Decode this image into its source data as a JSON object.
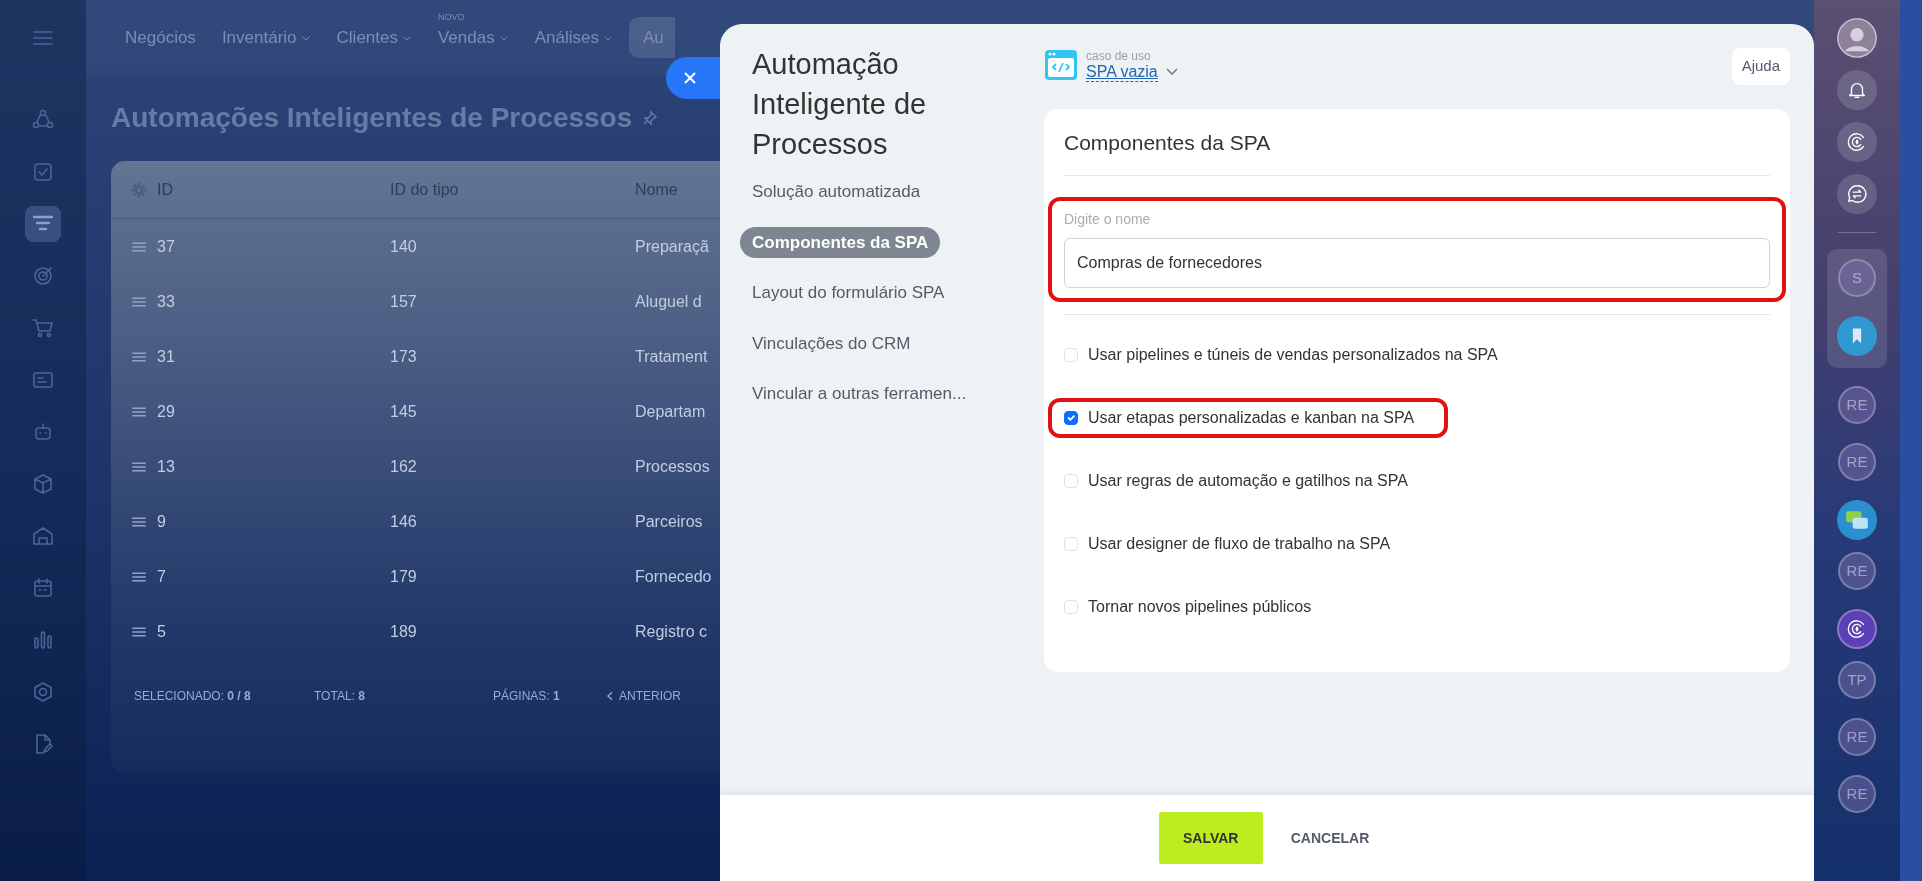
{
  "left_sidebar": {
    "items": [
      {
        "selected": false
      },
      {
        "selected": false
      },
      {
        "selected": false
      },
      {
        "selected": true
      },
      {
        "selected": false
      },
      {
        "selected": false
      },
      {
        "selected": false
      },
      {
        "selected": false
      },
      {
        "selected": false
      },
      {
        "selected": false
      },
      {
        "selected": false
      },
      {
        "selected": false
      },
      {
        "selected": false
      },
      {
        "selected": false
      }
    ]
  },
  "top_nav": {
    "tabs": [
      {
        "label": "Negócios",
        "has_menu": false,
        "selected": false
      },
      {
        "label": "Inventário",
        "has_menu": true,
        "selected": false
      },
      {
        "label": "Clientes",
        "has_menu": true,
        "selected": false
      },
      {
        "label": "Vendas",
        "has_menu": true,
        "selected": false,
        "badge": "NOVO"
      },
      {
        "label": "Análises",
        "has_menu": true,
        "selected": false
      },
      {
        "label": "Au",
        "has_menu": false,
        "selected": true
      }
    ]
  },
  "page_title": "Automações Inteligentes de Processos",
  "table": {
    "columns": [
      "ID",
      "ID do tipo",
      "Nome"
    ],
    "rows": [
      {
        "id": "37",
        "type_id": "140",
        "name": "Preparaçã"
      },
      {
        "id": "33",
        "type_id": "157",
        "name": "Aluguel d"
      },
      {
        "id": "31",
        "type_id": "173",
        "name": "Tratament"
      },
      {
        "id": "29",
        "type_id": "145",
        "name": "Departam"
      },
      {
        "id": "13",
        "type_id": "162",
        "name": "Processos"
      },
      {
        "id": "9",
        "type_id": "146",
        "name": "Parceiros"
      },
      {
        "id": "7",
        "type_id": "179",
        "name": "Fornecedo"
      },
      {
        "id": "5",
        "type_id": "189",
        "name": "Registro c"
      }
    ],
    "footer": {
      "selected": "SELECIONADO: **0 / 8**",
      "total": "TOTAL: **8**",
      "pages": "PÁGINAS: **1**",
      "previous": "ANTERIOR"
    }
  },
  "slider": {
    "title": "Automação Inteligente de Processos",
    "nav": [
      {
        "label": "Solução automatizada",
        "selected": false
      },
      {
        "label": "Componentes da SPA",
        "selected": true
      },
      {
        "label": "Layout do formulário SPA",
        "selected": false
      },
      {
        "label": "Vinculações do CRM",
        "selected": false
      },
      {
        "label": "Vincular a outras ferramen...",
        "selected": false
      }
    ],
    "use_case": {
      "label": "caso de uso",
      "value": "SPA vazia"
    },
    "help_button": "Ajuda",
    "card": {
      "title": "Componentes da SPA",
      "name_field": {
        "label": "Digite o nome",
        "value": "Compras de fornecedores",
        "highlighted": true
      },
      "options": [
        {
          "label": "Usar pipelines e túneis de vendas personalizados na SPA",
          "checked": false,
          "highlighted": false
        },
        {
          "label": "Usar etapas personalizadas e kanban na SPA",
          "checked": true,
          "highlighted": true
        },
        {
          "label": "Usar regras de automação e gatilhos na SPA",
          "checked": false,
          "highlighted": false
        },
        {
          "label": "Usar designer de fluxo de trabalho na SPA",
          "checked": false,
          "highlighted": false
        },
        {
          "label": "Tornar novos pipelines públicos",
          "checked": false,
          "highlighted": false
        }
      ]
    },
    "buttons": {
      "save": "SALVAR",
      "cancel": "CANCELAR"
    }
  },
  "right_sidebar": {
    "top": [
      {
        "kind": "avatar"
      },
      {
        "kind": "bell"
      },
      {
        "kind": "ai"
      },
      {
        "kind": "swap"
      }
    ],
    "pinned": [
      {
        "kind": "initials",
        "text": "S"
      },
      {
        "kind": "bookmark"
      }
    ],
    "chats": [
      {
        "kind": "initials",
        "text": "RE"
      },
      {
        "kind": "initials",
        "text": "RE"
      },
      {
        "kind": "chat"
      },
      {
        "kind": "initials",
        "text": "RE"
      },
      {
        "kind": "copilot"
      },
      {
        "kind": "initials",
        "text": "TP"
      },
      {
        "kind": "initials",
        "text": "RE"
      },
      {
        "kind": "initials",
        "text": "RE"
      }
    ]
  }
}
